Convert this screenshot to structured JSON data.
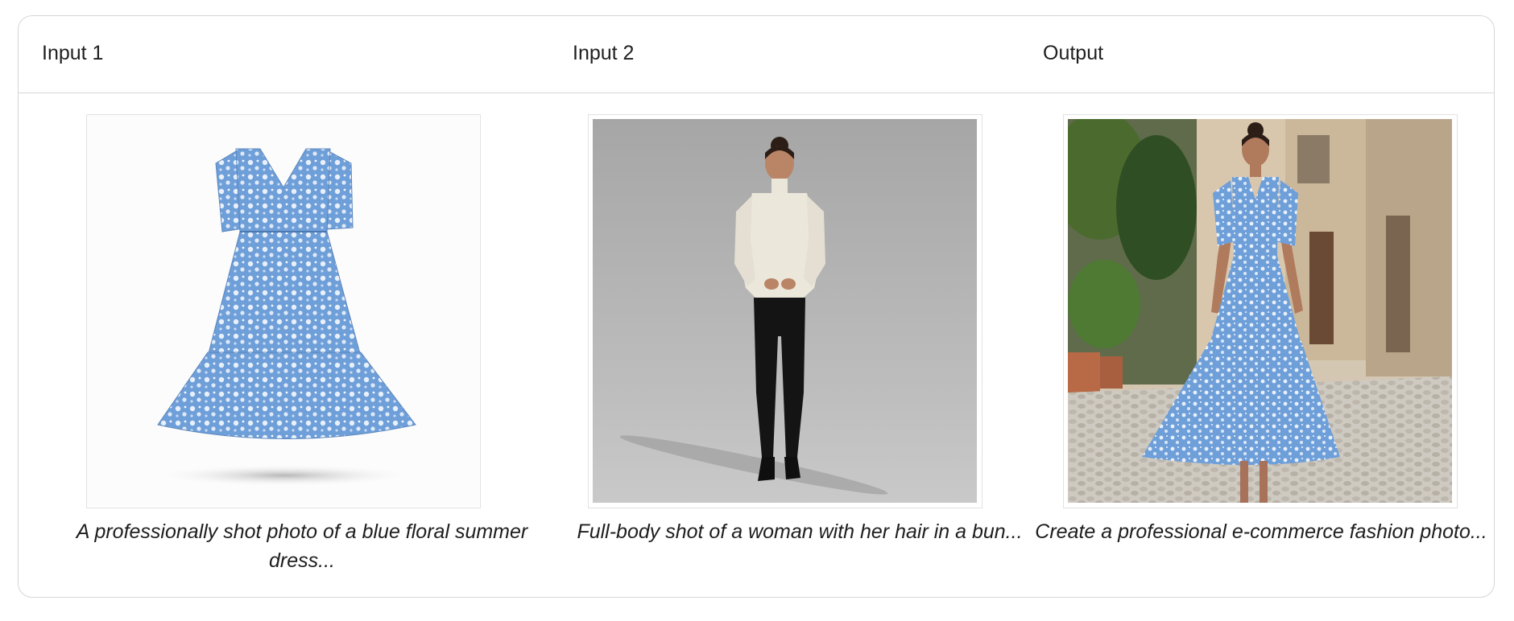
{
  "headers": {
    "input1": "Input 1",
    "input2": "Input 2",
    "output": "Output"
  },
  "captions": {
    "input1": "A professionally shot photo of a blue floral summer dress...",
    "input2": "Full-body shot of a woman with her hair in a bun...",
    "output": "Create a professional e-commerce fashion photo..."
  },
  "images": {
    "input1": "blue-floral-dress-product-image",
    "input2": "woman-in-turtleneck-studio-image",
    "output": "woman-in-floral-dress-street-image"
  },
  "colors": {
    "border": "#d6d6d6",
    "dress_blue": "#6f9fd8",
    "text": "#202020"
  }
}
